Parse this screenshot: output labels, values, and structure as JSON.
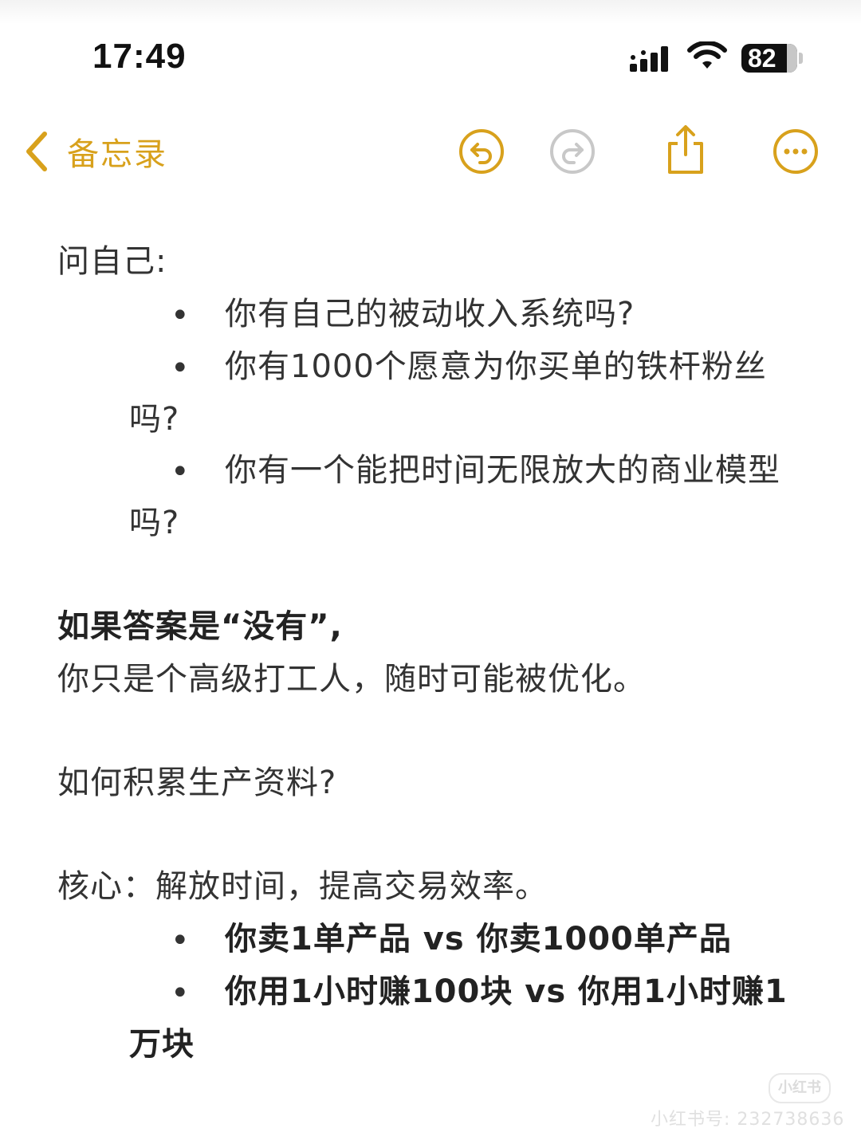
{
  "status_bar": {
    "time": "17:49",
    "battery": "82",
    "battery_level_percent": 82,
    "icons": [
      "signal-icon",
      "wifi-icon",
      "battery-icon"
    ]
  },
  "nav": {
    "back_label": "备忘录",
    "accent_color": "#d8a11c",
    "icons": [
      "chevron-left-icon",
      "undo-icon",
      "redo-icon",
      "share-icon",
      "more-icon"
    ]
  },
  "note": {
    "question_heading": "问自己:",
    "questions": [
      {
        "text": "你有自己的被动收入系统吗?"
      },
      {
        "text": "你有1000个愿意为你买单的铁杆粉丝",
        "continuation": "吗?"
      },
      {
        "text": "你有一个能把时间无限放大的商业模型",
        "continuation": "吗?"
      }
    ],
    "answer_bold": "如果答案是“没有”,",
    "answer_text": "你只是个高级打工人，随时可能被优化。",
    "how_question": "如何积累生产资料?",
    "core_text": "核心：解放时间，提高交易效率。",
    "core_items": [
      {
        "text": "你卖1单产品 vs 你卖1000单产品"
      },
      {
        "text": "你用1小时赚100块 vs 你用1小时赚1",
        "continuation": "万块"
      }
    ]
  },
  "watermark": {
    "brand": "小红书",
    "id_text": "小红书号: 232738636"
  }
}
